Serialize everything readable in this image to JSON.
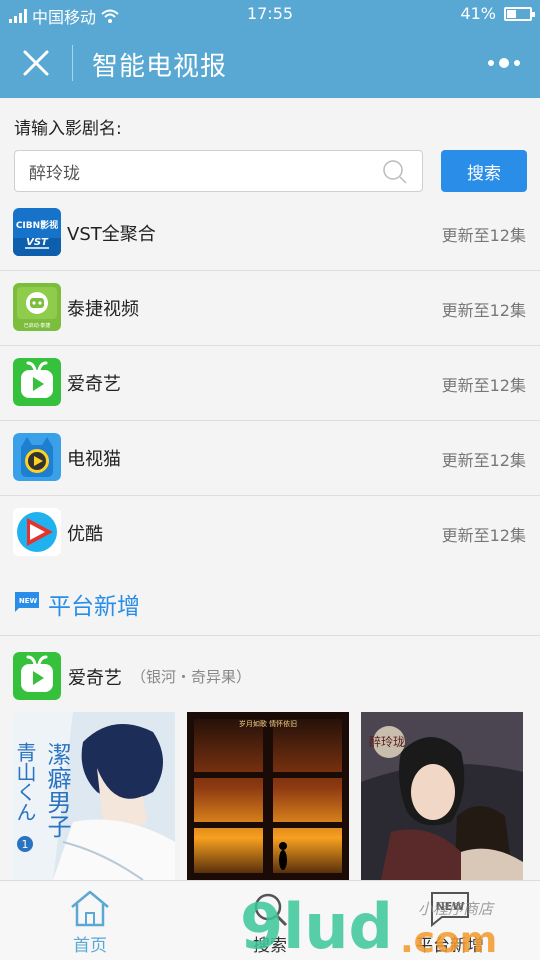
{
  "status_bar": {
    "carrier": "中国移动",
    "time": "17:55",
    "battery_percent": "41%",
    "battery_level": 0.41
  },
  "header": {
    "title": "智能电视报",
    "close_icon": "close-icon",
    "more_icon": "more-dots-icon"
  },
  "search": {
    "label": "请输入影剧名:",
    "value": "醉玲珑",
    "button_label": "搜索",
    "icon": "search-icon"
  },
  "platforms": [
    {
      "name": "VST全聚合",
      "update": "更新至12集",
      "icon": "vst-app-icon",
      "icon_text": "CIBN影视 VST"
    },
    {
      "name": "泰捷视频",
      "update": "更新至12集",
      "icon": "taijie-app-icon",
      "icon_text": "已启动·泰捷"
    },
    {
      "name": "爱奇艺",
      "update": "更新至12集",
      "icon": "iqiyi-app-icon"
    },
    {
      "name": "电视猫",
      "update": "更新至12集",
      "icon": "dianshimao-app-icon"
    },
    {
      "name": "优酷",
      "update": "更新至12集",
      "icon": "youku-app-icon"
    }
  ],
  "new_section": {
    "title": "平台新增",
    "flag_text": "NEW",
    "platform": {
      "name": "爱奇艺",
      "subtitle": "（银河・奇异果）",
      "icon": "iqiyi-app-icon"
    },
    "posters": [
      {
        "title": "潔癖男子",
        "subtitle": "青山くん",
        "number": "1",
        "icon": "anime-poster"
      },
      {
        "title": "岁月如歌 情怀依旧",
        "icon": "sunset-poster"
      },
      {
        "title": "醉玲珑",
        "icon": "drama-poster"
      }
    ]
  },
  "bottom_nav": [
    {
      "label": "首页",
      "icon": "home-icon",
      "active": true
    },
    {
      "label": "搜索",
      "icon": "search-icon",
      "active": false
    },
    {
      "label": "平台新增",
      "icon": "new-badge-icon",
      "active": false
    }
  ],
  "watermark": {
    "text": "9lud.com",
    "shop_text": "小程序商店"
  },
  "colors": {
    "header_bg": "#58a8d3",
    "accent_blue": "#2a8ee8",
    "iqiyi_green": "#35c13c",
    "text_gray": "#777777"
  }
}
